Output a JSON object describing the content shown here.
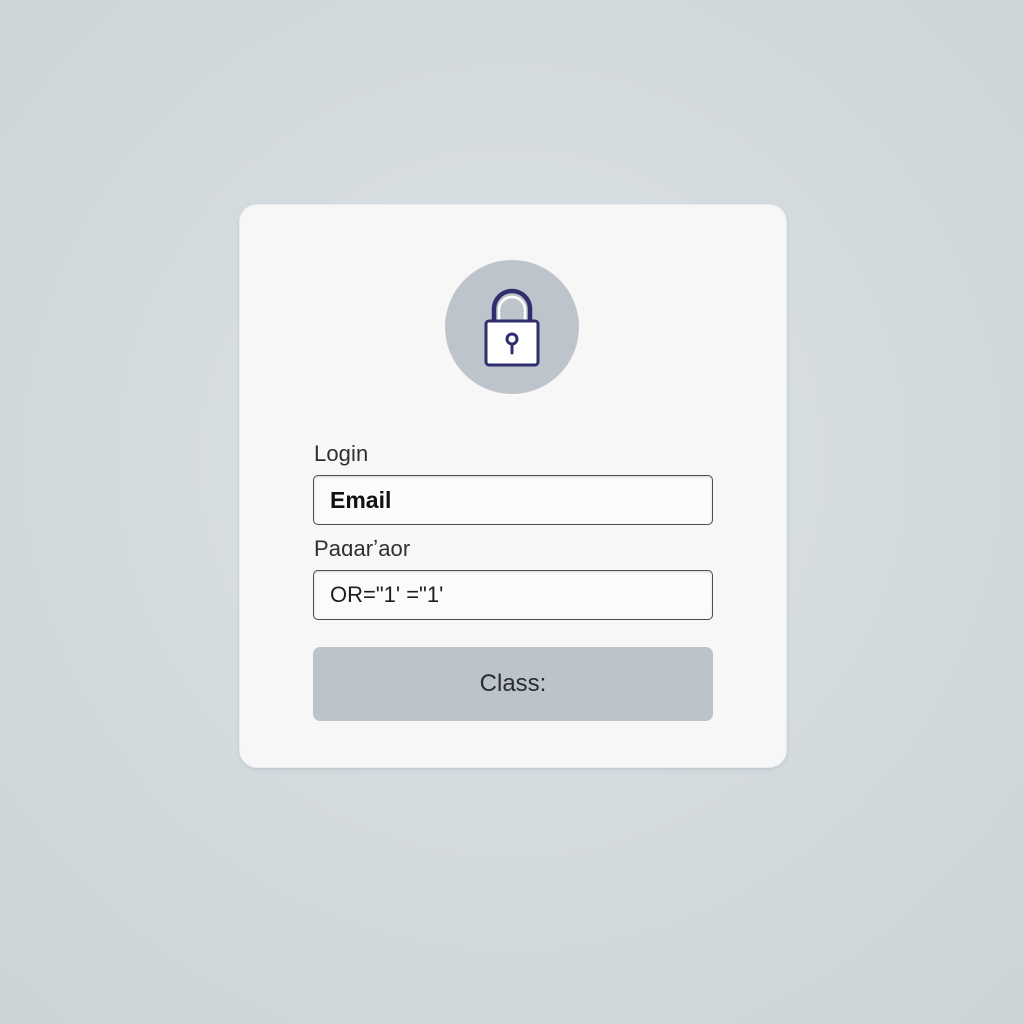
{
  "login_form": {
    "lock_icon": "lock-icon",
    "login_label": "Login",
    "email_placeholder": "Email",
    "password_label": "Paɑarʼaor",
    "password_value": "OR=\"1' =\"1'",
    "submit_label": "Class:"
  },
  "colors": {
    "background": "#d3dade",
    "card": "#f7f7f7",
    "badge": "#bdc4cb",
    "lock_stroke": "#2f2f6e",
    "button": "#bcc4ca"
  }
}
